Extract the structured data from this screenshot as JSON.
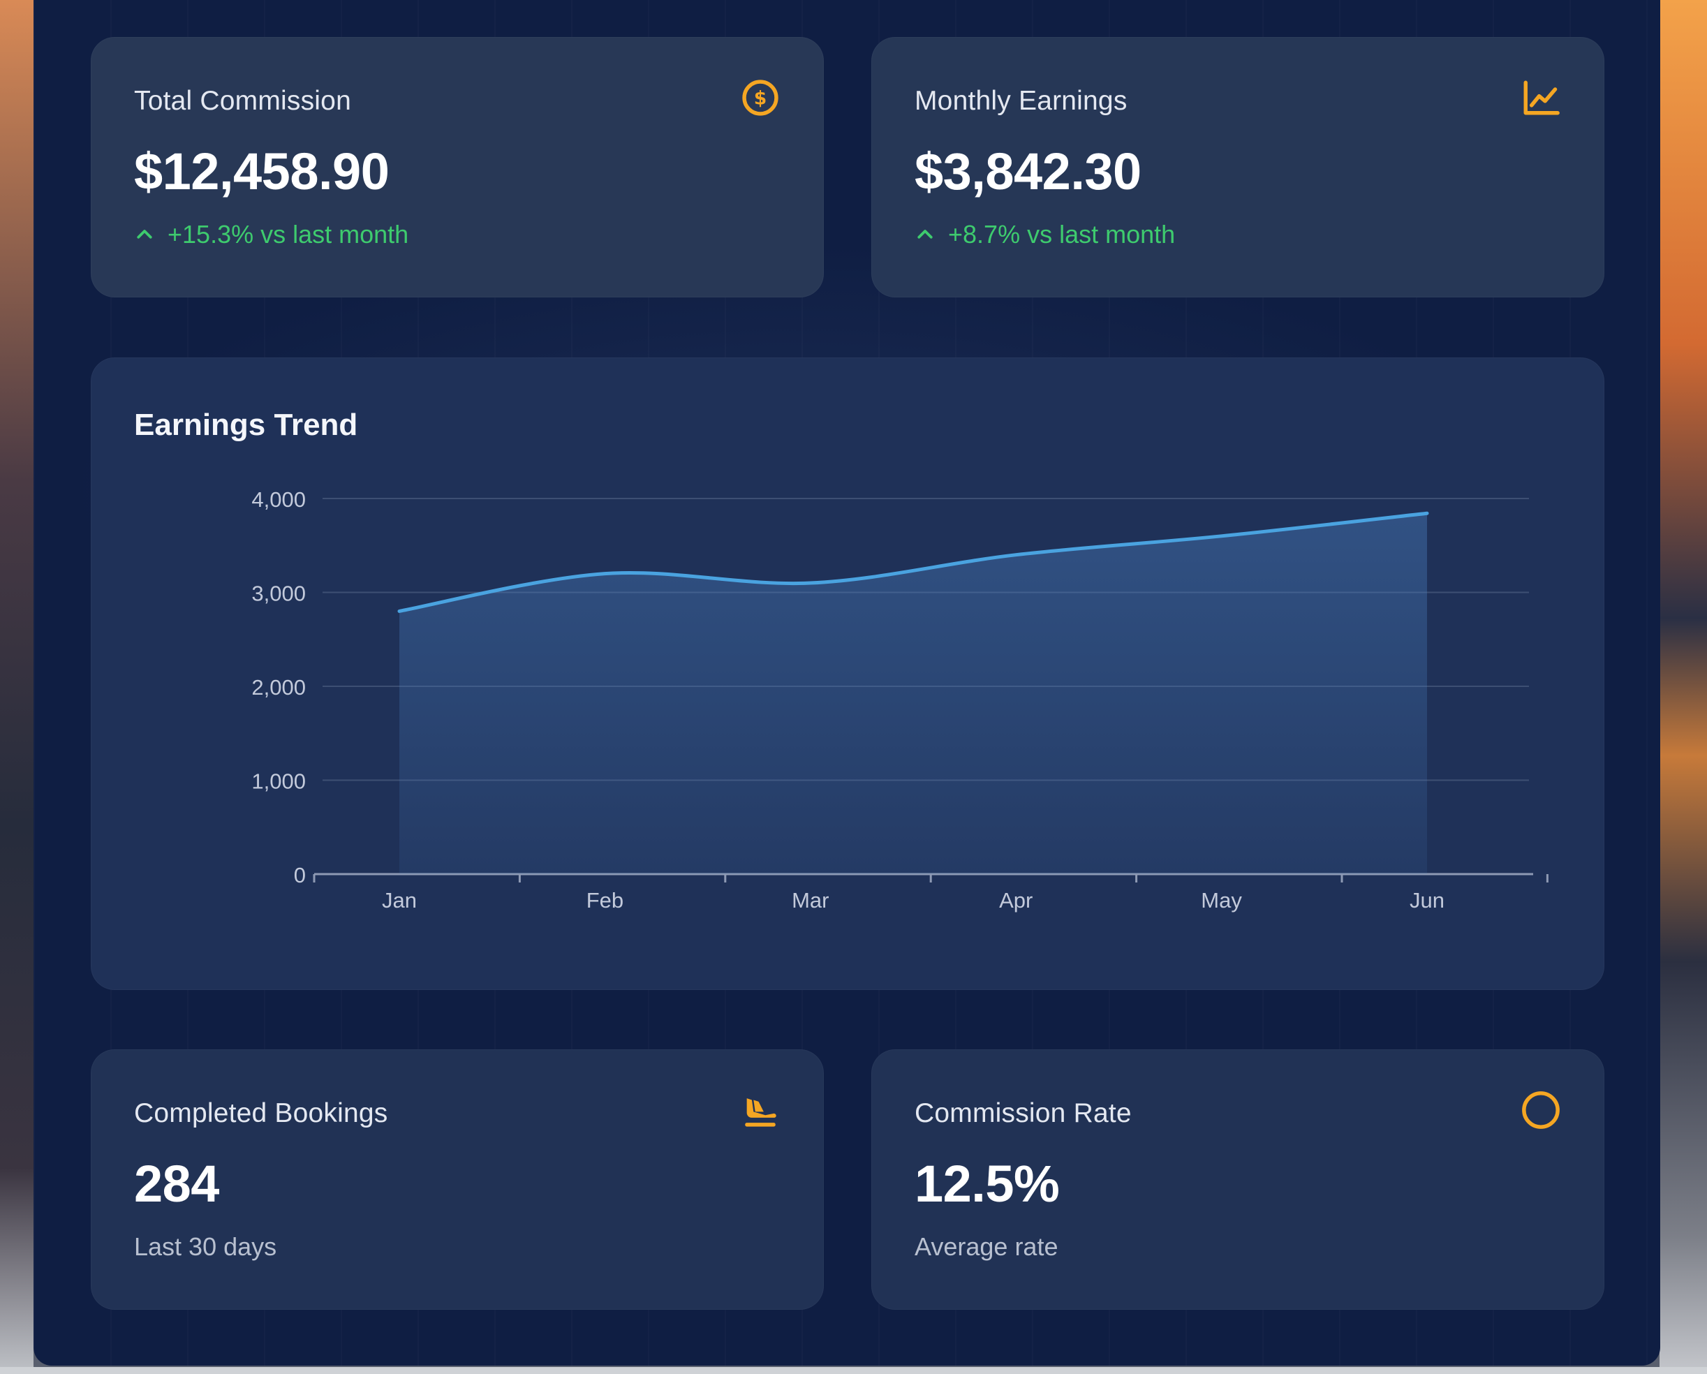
{
  "cards": {
    "total_commission": {
      "label": "Total Commission",
      "value": "$12,458.90",
      "trend": "+15.3% vs last month",
      "icon": "dollar-circle-icon"
    },
    "monthly_earnings": {
      "label": "Monthly Earnings",
      "value": "$3,842.30",
      "trend": "+8.7% vs last month",
      "icon": "line-chart-icon"
    },
    "completed_bookings": {
      "label": "Completed Bookings",
      "value": "284",
      "sub": "Last 30 days",
      "icon": "plane-landing-icon"
    },
    "commission_rate": {
      "label": "Commission Rate",
      "value": "12.5%",
      "sub": "Average rate",
      "icon": "circle-icon"
    }
  },
  "colors": {
    "accent": "#f5a623",
    "positive": "#3ecb6e",
    "line": "#4aa3e0",
    "panel": "#0f1e43",
    "card": "#22335a"
  },
  "chart_data": {
    "type": "area",
    "title": "Earnings Trend",
    "categories": [
      "Jan",
      "Feb",
      "Mar",
      "Apr",
      "May",
      "Jun"
    ],
    "values": [
      2800,
      3200,
      3100,
      3400,
      3600,
      3842.3
    ],
    "ylim": [
      0,
      4000
    ],
    "yticks": [
      0,
      1000,
      2000,
      3000,
      4000
    ],
    "ytick_labels": [
      "0",
      "1,000",
      "2,000",
      "3,000",
      "4,000"
    ],
    "grid": true,
    "legend": "none"
  }
}
